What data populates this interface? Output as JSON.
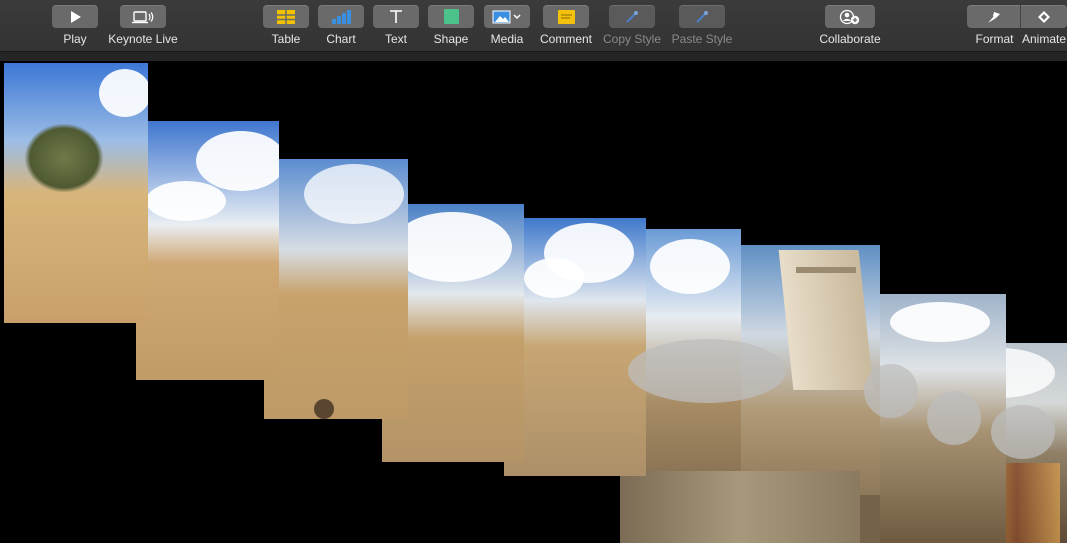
{
  "toolbar": {
    "items": [
      {
        "label": "Play",
        "icon": "play-icon"
      },
      {
        "label": "Keynote Live",
        "icon": "keynote-live-icon"
      },
      {
        "label": "Table",
        "icon": "table-icon"
      },
      {
        "label": "Chart",
        "icon": "chart-icon"
      },
      {
        "label": "Text",
        "icon": "text-icon"
      },
      {
        "label": "Shape",
        "icon": "shape-icon"
      },
      {
        "label": "Media",
        "icon": "media-icon"
      },
      {
        "label": "Comment",
        "icon": "comment-icon"
      },
      {
        "label": "Copy Style",
        "icon": "copy-style-icon",
        "disabled": true
      },
      {
        "label": "Paste Style",
        "icon": "paste-style-icon",
        "disabled": true
      },
      {
        "label": "Collaborate",
        "icon": "collaborate-icon"
      },
      {
        "label": "Format",
        "icon": "format-icon"
      },
      {
        "label": "Animate",
        "icon": "animate-icon"
      }
    ]
  },
  "colors": {
    "toolbar_bg": "#383838",
    "button_bg": "#6a6a6a",
    "table_yellow": "#f2c200",
    "chart_blue": "#3a8fe0",
    "shape_green": "#4cc38a",
    "comment_yellow": "#f4c20d",
    "sky_blue": "#4a86d8",
    "sand": "#c9a06a"
  },
  "canvas": {
    "description_items": [
      "panorama-photo-1",
      "panorama-photo-2",
      "panorama-photo-3",
      "panorama-photo-4",
      "panorama-photo-5",
      "panorama-photo-6",
      "panorama-photo-7",
      "panorama-photo-8",
      "panorama-photo-9"
    ]
  }
}
